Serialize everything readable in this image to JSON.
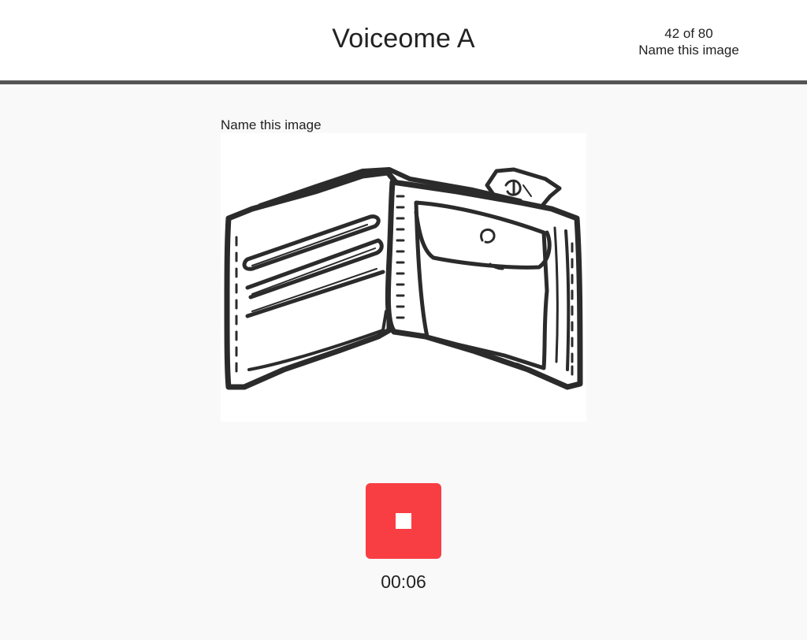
{
  "header": {
    "title": "Voiceome A",
    "progress_count": "42 of 80",
    "progress_task": "Name this image"
  },
  "task": {
    "prompt": "Name this image",
    "image_subject": "wallet-illustration"
  },
  "recorder": {
    "state": "recording",
    "button_icon": "stop-icon",
    "button_color": "#f93e43",
    "elapsed": "00:06"
  },
  "colors": {
    "header_rule": "#555555",
    "page_background": "#f9f9f9"
  }
}
